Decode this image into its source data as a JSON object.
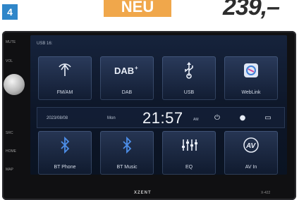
{
  "promo": {
    "number": "4",
    "tag": "NEU",
    "price": "239,–"
  },
  "device": {
    "statusbar": "USB 16:",
    "brand": "XZENT",
    "model": "X-422",
    "side_labels": [
      "MUTE",
      "VOL",
      "SRC",
      "HOME",
      "MAP"
    ]
  },
  "tiles_top": [
    {
      "label": "FM/AM",
      "icon": "radio-antenna-icon"
    },
    {
      "label": "DAB",
      "icon": "dab-plus-icon"
    },
    {
      "label": "USB",
      "icon": "usb-icon"
    },
    {
      "label": "WebLink",
      "icon": "weblink-icon"
    }
  ],
  "clock": {
    "date": "2023/08/08",
    "day": "Mon",
    "time": "21:57",
    "ampm": "AM"
  },
  "tiles_bottom": [
    {
      "label": "BT Phone",
      "icon": "bluetooth-icon"
    },
    {
      "label": "BT Music",
      "icon": "bluetooth-music-icon"
    },
    {
      "label": "EQ",
      "icon": "equalizer-icon"
    },
    {
      "label": "AV In",
      "icon": "av-in-icon"
    }
  ]
}
